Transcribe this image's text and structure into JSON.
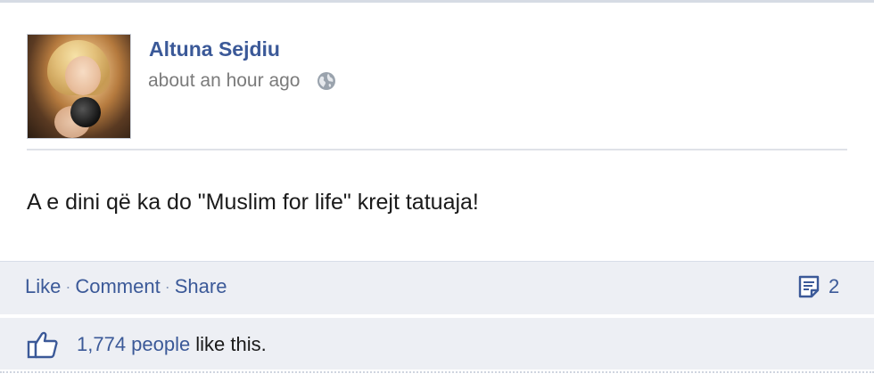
{
  "post": {
    "author": "Altuna Sejdiu",
    "timestamp": "about an hour ago",
    "privacy_icon": "globe-icon",
    "text": "A e dini që ka do \"Muslim for life\" krejt tatuaja!"
  },
  "actions": {
    "like": "Like",
    "separator": "·",
    "comment": "Comment",
    "share": "Share",
    "comment_icon": "comment-icon",
    "comment_count": "2"
  },
  "likes": {
    "icon": "thumbs-up-icon",
    "people": "1,774 people",
    "suffix": "like this."
  },
  "colors": {
    "link": "#3b5998",
    "bar_background": "#edeff4",
    "meta_text": "#7b7b7b"
  }
}
